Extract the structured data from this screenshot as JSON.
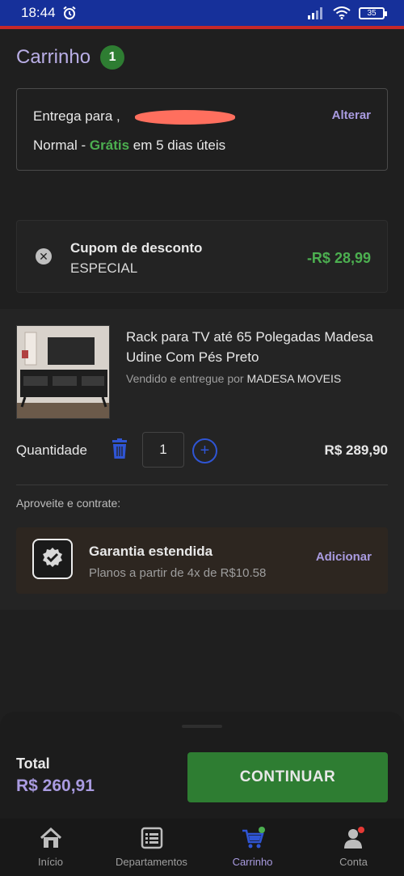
{
  "status_bar": {
    "time": "18:44",
    "battery": "35"
  },
  "header": {
    "title": "Carrinho",
    "count": "1"
  },
  "delivery": {
    "prefix": "Entrega para ,",
    "type": "Normal",
    "separator": " - ",
    "free": "Grátis",
    "eta": " em 5 dias úteis",
    "alter_label": "Alterar"
  },
  "coupon": {
    "title": "Cupom de desconto",
    "code": "ESPECIAL",
    "value": "-R$ 28,99"
  },
  "item": {
    "name": "Rack para TV até 65 Polegadas Madesa Udine Com Pés Preto",
    "seller_prefix": "Vendido e entregue por ",
    "seller": "MADESA MOVEIS",
    "quantity_label": "Quantidade",
    "quantity": "1",
    "price": "R$ 289,90"
  },
  "upsell": {
    "label": "Aproveite e contrate:",
    "title": "Garantia estendida",
    "subtitle": "Planos a partir de 4x de R$10.58",
    "action": "Adicionar"
  },
  "total": {
    "label": "Total",
    "value": "R$ 260,91",
    "button": "CONTINUAR"
  },
  "nav": [
    {
      "label": "Início",
      "icon": "home-icon"
    },
    {
      "label": "Departamentos",
      "icon": "list-icon"
    },
    {
      "label": "Carrinho",
      "icon": "cart-icon",
      "active": true
    },
    {
      "label": "Conta",
      "icon": "user-icon"
    }
  ],
  "colors": {
    "accent": "#a99be0",
    "green": "#2e7d32",
    "blue_link": "#2f55d4",
    "statusbar": "#16309a"
  }
}
